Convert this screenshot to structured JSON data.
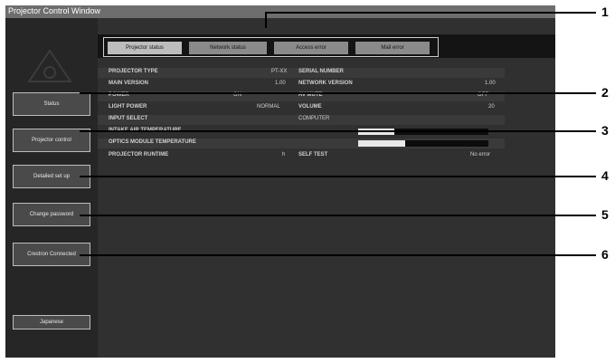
{
  "window": {
    "title": "Projector Control Window"
  },
  "sidebar": {
    "items": [
      {
        "label": "Status",
        "name": "sidebar-status"
      },
      {
        "label": "Projector control",
        "name": "sidebar-projector-control"
      },
      {
        "label": "Detailed set up",
        "name": "sidebar-detailed-setup"
      },
      {
        "label": "Change password",
        "name": "sidebar-change-password"
      },
      {
        "label": "Crestron Connected",
        "name": "sidebar-crestron"
      },
      {
        "label": "Japanese",
        "name": "sidebar-language"
      }
    ]
  },
  "tabs": [
    {
      "label": "Projector status",
      "active": true
    },
    {
      "label": "Network status",
      "active": false
    },
    {
      "label": "Access error",
      "active": false
    },
    {
      "label": "Mail error",
      "active": false
    }
  ],
  "status": {
    "rows": [
      {
        "label1": "PROJECTOR TYPE",
        "value1": "PT-XX",
        "label2": "SERIAL NUMBER",
        "value2": ""
      },
      {
        "label1": "MAIN VERSION",
        "value1": "1.00",
        "label2": "NETWORK VERSION",
        "value2": "1.00"
      },
      {
        "label1": "POWER",
        "value1": "ON",
        "label2": "AV MUTE",
        "value2": "OFF"
      },
      {
        "label1": "LIGHT POWER",
        "value1": "NORMAL",
        "label2": "VOLUME",
        "value2": "20"
      },
      {
        "label1": "INPUT SELECT",
        "value1": "COMPUTER",
        "label2": "",
        "value2": ""
      },
      {
        "label1": "INTAKE AIR TEMPERATURE",
        "value1": "",
        "label2": "",
        "value2": "",
        "bar_fill": 0.28
      },
      {
        "label1": "OPTICS MODULE TEMPERATURE",
        "value1": "",
        "label2": "",
        "value2": "",
        "bar_fill": 0.36
      },
      {
        "label1": "PROJECTOR RUNTIME",
        "value1": "h",
        "label2": "SELF TEST",
        "value2": "No error"
      }
    ]
  },
  "callouts": [
    "1",
    "2",
    "3",
    "4",
    "5",
    "6"
  ],
  "colors": {
    "bar_fill": "#e8e8e8",
    "bar_track": "#0c0c0c",
    "tab_active": "#bdbdbd",
    "tab": "#8a8a8a"
  }
}
